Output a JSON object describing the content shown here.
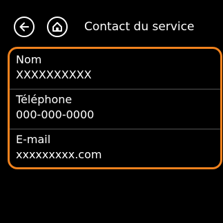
{
  "header": {
    "title": "Contact du service",
    "back_icon": "arrow-left-icon",
    "home_icon": "home-icon"
  },
  "contact": {
    "fields": [
      {
        "label": "Nom",
        "value": "XXXXXXXXXX"
      },
      {
        "label": "Téléphone",
        "value": "000-000-0000"
      },
      {
        "label": "E-mail",
        "value": "xxxxxxxxx.com"
      }
    ]
  },
  "colors": {
    "accent": "#f0821e",
    "background": "#000000",
    "text": "#ffffff"
  }
}
